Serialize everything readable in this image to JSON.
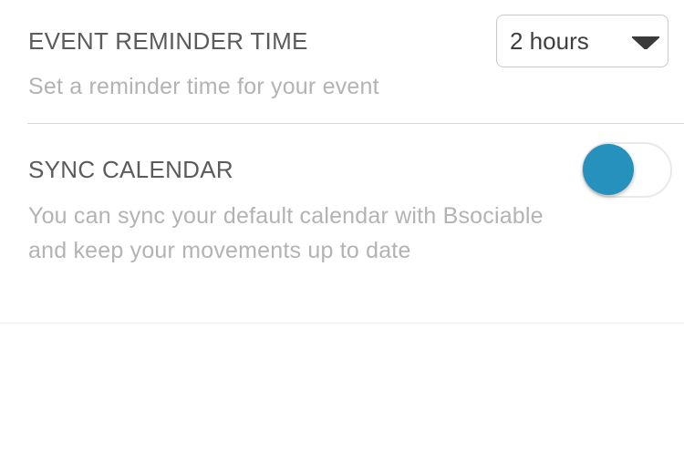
{
  "reminder": {
    "title": "EVENT REMINDER TIME",
    "description": "Set a reminder time for your event",
    "select": {
      "value": "2 hours",
      "icon": "caret-down-icon"
    }
  },
  "sync": {
    "title": "SYNC CALENDAR",
    "description": "You can sync your default calendar with Bsociable and keep your movements up to date",
    "toggle": {
      "on": false
    }
  },
  "colors": {
    "toggle_knob": "#2691bd",
    "title_text": "#5b5b5b",
    "description_text": "#b3b3b3",
    "divider": "#d6d6d6"
  }
}
